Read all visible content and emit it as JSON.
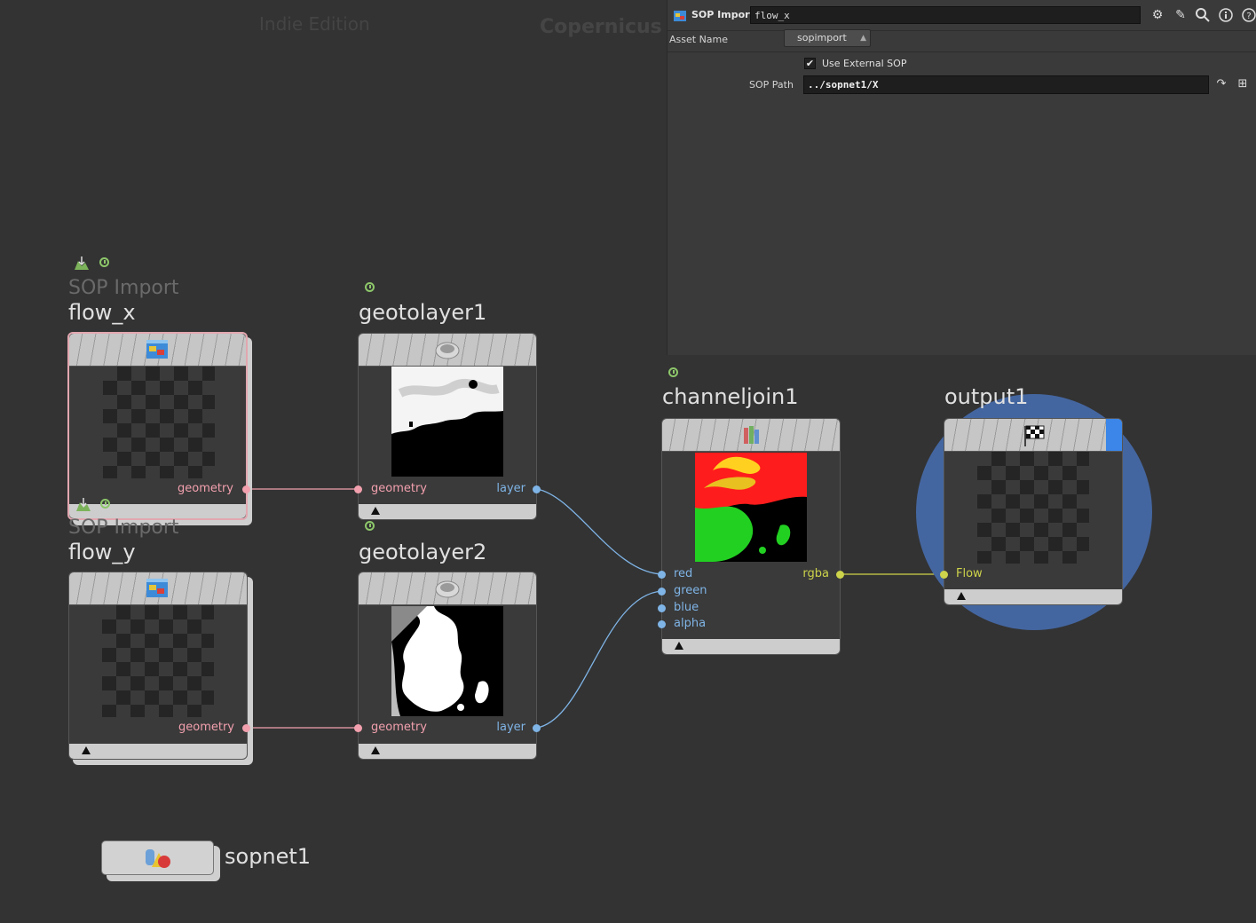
{
  "network": {
    "edition": "Indie Edition",
    "context": "Copernicus"
  },
  "param_pane": {
    "node_type": "SOP Import",
    "node_name": "flow_x",
    "asset_name_label": "Asset Name",
    "asset_name_value": "sopimport",
    "use_external_sop_label": "Use External SOP",
    "use_external_sop_checked": true,
    "sop_path_label": "SOP Path",
    "sop_path_value": "../sopnet1/X",
    "header_icons": [
      "gear-icon",
      "brush-icon",
      "search-icon",
      "info-icon",
      "help-icon"
    ]
  },
  "nodes": {
    "flow_x": {
      "type_label": "SOP Import",
      "name": "flow_x",
      "output_label": "geometry"
    },
    "flow_y": {
      "type_label": "SOP Import",
      "name": "flow_y",
      "output_label": "geometry"
    },
    "geotolayer1": {
      "name": "geotolayer1",
      "input_label": "geometry",
      "output_label": "layer"
    },
    "geotolayer2": {
      "name": "geotolayer2",
      "input_label": "geometry",
      "output_label": "layer"
    },
    "channeljoin1": {
      "name": "channeljoin1",
      "inputs": [
        "red",
        "green",
        "blue",
        "alpha"
      ],
      "output_label": "rgba"
    },
    "output1": {
      "name": "output1",
      "input_label": "Flow"
    },
    "sopnet1": {
      "name": "sopnet1"
    }
  },
  "colors": {
    "background": "#333333",
    "geometry_wire": "#f2a0ae",
    "layer_wire": "#7fb4e6",
    "rgba_wire": "#cdd34a",
    "output_highlight": "#4466a0",
    "display_flag": "#3b86e8"
  }
}
